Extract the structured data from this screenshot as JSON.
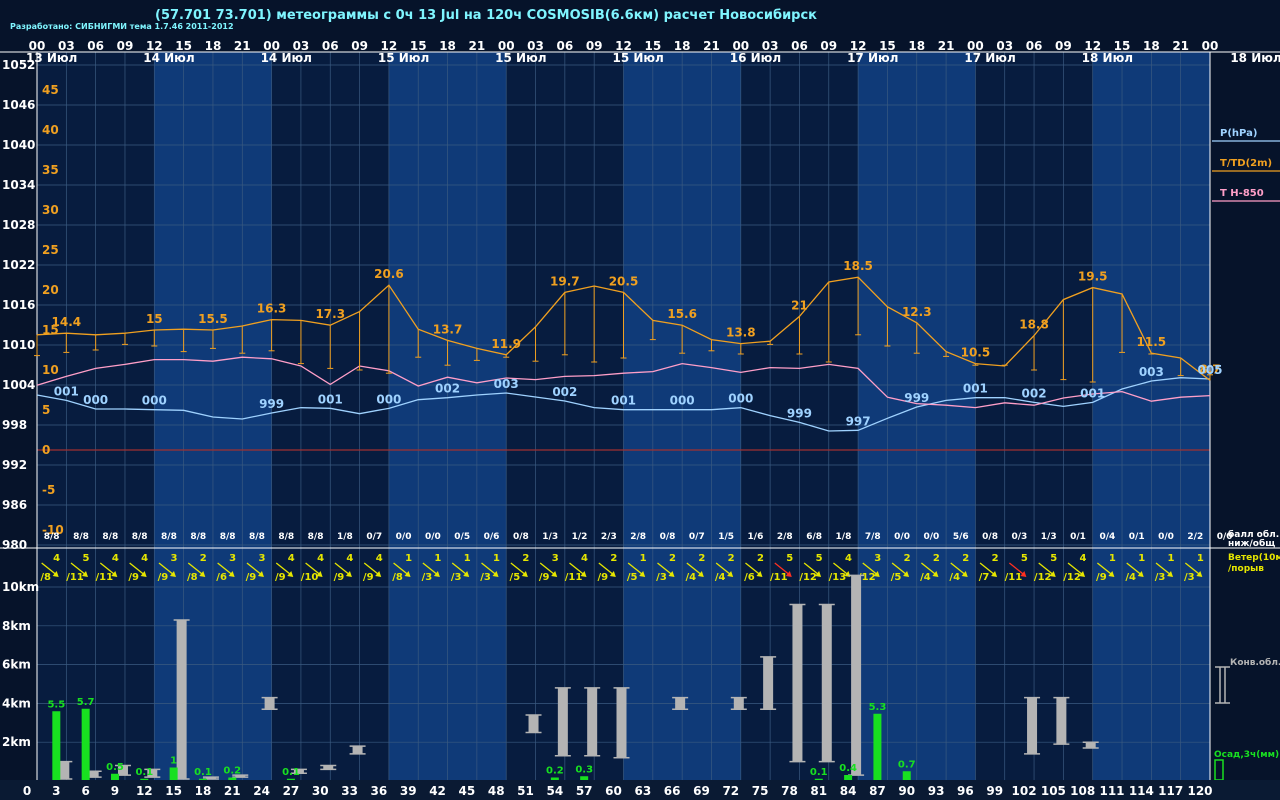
{
  "header": {
    "title": "(57.701 73.701) метеограммы с  0ч 13 Jul на 120ч COSMOSIB(6.6км) расчет Новосибирск",
    "credit": "Разработано: СИБНИГМИ тема 1.7.46 2011-2012"
  },
  "colors": {
    "bg": "#06132a",
    "band_dark": "#071c3f",
    "band_light": "#0f3a78",
    "grid": "#3a5a80",
    "pressure": "#9fd2ff",
    "temp": "#f0a020",
    "t850": "#ff9fc8",
    "rain": "#18e020",
    "cloud": "#b4b4b4",
    "wind": "#e6e600",
    "wind_red": "#ff3020",
    "zero": "#a03030",
    "axis_text": "#ffffff"
  },
  "chart_data": {
    "type": "line",
    "time_labels_top": [
      "00",
      "03",
      "06",
      "09",
      "12",
      "15",
      "18",
      "21",
      "00",
      "03",
      "06",
      "09",
      "12",
      "15",
      "18",
      "21",
      "00",
      "03",
      "06",
      "09",
      "12",
      "15",
      "18",
      "21",
      "00",
      "03",
      "06",
      "09",
      "12",
      "15",
      "18",
      "21",
      "00",
      "03",
      "06",
      "09",
      "12",
      "15",
      "18",
      "21",
      "00"
    ],
    "day_labels": [
      {
        "label": "13 Июл",
        "h": 1.5
      },
      {
        "label": "14 Июл",
        "h": 13.5
      },
      {
        "label": "14 Июл",
        "h": 25.5
      },
      {
        "label": "15 Июл",
        "h": 37.5
      },
      {
        "label": "15 Июл",
        "h": 49.5
      },
      {
        "label": "15 Июл",
        "h": 61.5
      },
      {
        "label": "16 Июл",
        "h": 73.5
      },
      {
        "label": "17 Июл",
        "h": 85.5
      },
      {
        "label": "17 Июл",
        "h": 97.5
      },
      {
        "label": "18 Июл",
        "h": 109.5
      }
    ],
    "right_day_label": "18 Июл",
    "pressure_ticks": [
      "1052",
      "1046",
      "1040",
      "1034",
      "1028",
      "1022",
      "1016",
      "1010",
      "1004",
      "998",
      "992",
      "986",
      "980"
    ],
    "temp_ticks": [
      "45",
      "40",
      "35",
      "30",
      "25",
      "20",
      "15",
      "10",
      "5",
      "0",
      "-5",
      "-10"
    ],
    "legend": [
      "P(hPa)",
      "T/TD(2m)",
      "T H-850"
    ],
    "hours": [
      0,
      3,
      6,
      9,
      12,
      15,
      18,
      21,
      24,
      27,
      30,
      33,
      36,
      39,
      42,
      45,
      48,
      51,
      54,
      57,
      60,
      63,
      66,
      69,
      72,
      75,
      78,
      81,
      84,
      87,
      90,
      93,
      96,
      99,
      102,
      105,
      108,
      111,
      114,
      117,
      120
    ],
    "series": [
      {
        "name": "P(hPa)",
        "values": [
          1002.5,
          1001.7,
          1000.4,
          1000.4,
          1000.3,
          1000.2,
          999.2,
          998.9,
          999.8,
          1000.6,
          1000.5,
          999.7,
          1000.5,
          1001.8,
          1002.1,
          1002.5,
          1002.8,
          1002.2,
          1001.6,
          1000.6,
          1000.3,
          1000.3,
          1000.3,
          1000.3,
          1000.6,
          999.4,
          998.4,
          997.1,
          997.2,
          999.0,
          1000.7,
          1001.7,
          1002.1,
          1002.1,
          1001.4,
          1000.8,
          1001.4,
          1003.4,
          1004.6,
          1005.1,
          1004.9
        ],
        "labels": [
          null,
          "001",
          "000",
          null,
          "000",
          null,
          null,
          null,
          "999",
          null,
          "001",
          null,
          "000",
          null,
          "002",
          null,
          "003",
          null,
          "002",
          null,
          "001",
          null,
          "000",
          null,
          "000",
          null,
          "999",
          null,
          "997",
          null,
          "999",
          null,
          "001",
          null,
          "002",
          null,
          "001",
          null,
          "003",
          null,
          "005"
        ]
      },
      {
        "name": "T/TD(2m)",
        "values": [
          14.4,
          14.6,
          14.4,
          14.6,
          15.0,
          15.1,
          15.0,
          15.5,
          16.3,
          16.2,
          15.6,
          17.3,
          20.6,
          15.1,
          13.7,
          12.7,
          11.9,
          15.4,
          19.7,
          20.5,
          19.7,
          16.2,
          15.6,
          13.8,
          13.3,
          13.6,
          16.7,
          21.0,
          21.6,
          17.9,
          15.9,
          12.3,
          10.8,
          10.5,
          14.3,
          18.8,
          20.3,
          19.5,
          12.1,
          11.5,
          8.7,
          9.0
        ],
        "labels": [
          null,
          "14.4",
          null,
          null,
          "15",
          null,
          "15.5",
          null,
          "16.3",
          null,
          "17.3",
          null,
          "20.6",
          null,
          "13.7",
          null,
          "11.9",
          null,
          "19.7",
          null,
          "20.5",
          null,
          "15.6",
          null,
          "13.8",
          null,
          "21",
          null,
          "18.5",
          null,
          "12.3",
          null,
          "10.5",
          null,
          "18.8",
          null,
          "19.5",
          null,
          "11.5",
          null,
          "8.7"
        ],
        "td": [
          11.8,
          12.2,
          12.5,
          13.2,
          13.0,
          12.3,
          12.7,
          12.1,
          12.4,
          10.8,
          10.2,
          10.0,
          9.6,
          11.6,
          10.6,
          11.2,
          11.6,
          11.1,
          11.9,
          11.0,
          11.5,
          13.8,
          12.1,
          12.4,
          12.0,
          13.2,
          12.0,
          11.0,
          14.4,
          13.0,
          12.1,
          11.7,
          10.6,
          10.6,
          10.0,
          8.8,
          8.5,
          12.2,
          12.0,
          9.3,
          9.4
        ]
      },
      {
        "name": "T H-850",
        "values": [
          8.1,
          9.2,
          10.2,
          10.7,
          11.3,
          11.3,
          11.1,
          11.6,
          11.4,
          10.5,
          8.2,
          10.5,
          9.9,
          8.0,
          9.1,
          8.4,
          9.0,
          8.8,
          9.2,
          9.3,
          9.6,
          9.8,
          10.8,
          10.3,
          9.7,
          10.3,
          10.2,
          10.7,
          10.2,
          6.6,
          5.8,
          5.6,
          5.3,
          5.9,
          5.6,
          6.5,
          7.0,
          7.3,
          6.1,
          6.6,
          6.8
        ]
      }
    ],
    "cloud_cover": [
      "8/8",
      "8/8",
      "8/8",
      "8/8",
      "8/8",
      "8/8",
      "8/8",
      "8/8",
      "8/8",
      "8/8",
      "1/8",
      "0/7",
      "0/0",
      "0/0",
      "0/5",
      "0/6",
      "0/8",
      "1/3",
      "1/2",
      "2/3",
      "2/8",
      "0/8",
      "0/7",
      "1/5",
      "1/6",
      "2/8",
      "6/8",
      "1/8",
      "7/8",
      "0/0",
      "0/0",
      "5/6",
      "0/8",
      "0/3",
      "1/3",
      "0/1",
      "0/4",
      "0/1",
      "0/0",
      "2/2",
      "0/0"
    ],
    "cloud_label": "балл обл. ниж/общ",
    "wind_label": [
      "Ветер(10м)",
      "/порыв"
    ],
    "wind": [
      {
        "speed": "4",
        "gust": "/8"
      },
      {
        "speed": "5",
        "gust": "/11"
      },
      {
        "speed": "4",
        "gust": "/11"
      },
      {
        "speed": "4",
        "gust": "/9"
      },
      {
        "speed": "3",
        "gust": "/9"
      },
      {
        "speed": "2",
        "gust": "/8"
      },
      {
        "speed": "3",
        "gust": "/6"
      },
      {
        "speed": "3",
        "gust": "/9"
      },
      {
        "speed": "4",
        "gust": "/9"
      },
      {
        "speed": "4",
        "gust": "/10"
      },
      {
        "speed": "4",
        "gust": "/9"
      },
      {
        "speed": "4",
        "gust": "/9"
      },
      {
        "speed": "1",
        "gust": "/8"
      },
      {
        "speed": "1",
        "gust": "/3"
      },
      {
        "speed": "1",
        "gust": "/3"
      },
      {
        "speed": "1",
        "gust": "/3"
      },
      {
        "speed": "2",
        "gust": "/5"
      },
      {
        "speed": "3",
        "gust": "/9"
      },
      {
        "speed": "4",
        "gust": "/11"
      },
      {
        "speed": "2",
        "gust": "/9"
      },
      {
        "speed": "1",
        "gust": "/5"
      },
      {
        "speed": "2",
        "gust": "/3"
      },
      {
        "speed": "2",
        "gust": "/4"
      },
      {
        "speed": "2",
        "gust": "/4"
      },
      {
        "speed": "2",
        "gust": "/6"
      },
      {
        "speed": "5",
        "gust": "/11"
      },
      {
        "speed": "5",
        "gust": "/12"
      },
      {
        "speed": "4",
        "gust": "/13"
      },
      {
        "speed": "3",
        "gust": "/12"
      },
      {
        "speed": "2",
        "gust": "/5"
      },
      {
        "speed": "2",
        "gust": "/4"
      },
      {
        "speed": "2",
        "gust": "/4"
      },
      {
        "speed": "2",
        "gust": "/7"
      },
      {
        "speed": "5",
        "gust": "/11"
      },
      {
        "speed": "5",
        "gust": "/12"
      },
      {
        "speed": "4",
        "gust": "/12"
      },
      {
        "speed": "1",
        "gust": "/9"
      },
      {
        "speed": "1",
        "gust": "/4"
      },
      {
        "speed": "1",
        "gust": "/3"
      },
      {
        "speed": "1",
        "gust": "/3"
      }
    ],
    "height_ticks": [
      "10km",
      "8km",
      "6km",
      "4km",
      "2km"
    ],
    "height_ylim": [
      0,
      11
    ],
    "conv_label": "Конв.обл.",
    "precip_label": "Осад,3ч(мм)",
    "precip_hours": [
      3,
      6,
      9,
      12,
      15,
      18,
      21,
      24,
      27,
      30,
      33,
      36,
      39,
      42,
      45,
      48,
      51,
      54,
      57,
      60,
      63,
      66,
      69,
      72,
      75,
      78,
      81,
      84,
      87,
      90,
      93,
      96,
      99,
      102,
      105,
      108,
      111,
      114,
      117,
      120
    ],
    "precip": [
      {
        "h": 3,
        "v": "5.5",
        "val": 5.5
      },
      {
        "h": 6,
        "v": "5.7",
        "val": 5.7
      },
      {
        "h": 9,
        "v": "0.5",
        "val": 0.5
      },
      {
        "h": 12,
        "v": "0.1",
        "val": 0.1
      },
      {
        "h": 15,
        "v": "1",
        "val": 1.0
      },
      {
        "h": 18,
        "v": "0.1",
        "val": 0.1
      },
      {
        "h": 21,
        "v": "0.2",
        "val": 0.2
      },
      {
        "h": 27,
        "v": "0.1",
        "val": 0.1
      },
      {
        "h": 54,
        "v": "0.2",
        "val": 0.2
      },
      {
        "h": 57,
        "v": "0.3",
        "val": 0.3
      },
      {
        "h": 81,
        "v": "0.1",
        "val": 0.1
      },
      {
        "h": 84,
        "v": "0.4",
        "val": 0.4
      },
      {
        "h": 87,
        "v": "5.3",
        "val": 5.3
      },
      {
        "h": 90,
        "v": "0.7",
        "val": 0.7
      }
    ],
    "conv_clouds": [
      {
        "h": 3,
        "bottom": 0.1,
        "top": 1.0
      },
      {
        "h": 6,
        "bottom": 0.2,
        "top": 0.5
      },
      {
        "h": 9,
        "bottom": 0.3,
        "top": 0.8
      },
      {
        "h": 12,
        "bottom": 0.2,
        "top": 0.6
      },
      {
        "h": 15,
        "bottom": 0.1,
        "top": 8.3
      },
      {
        "h": 18,
        "bottom": 0.1,
        "top": 0.2
      },
      {
        "h": 21,
        "bottom": 0.2,
        "top": 0.3
      },
      {
        "h": 24,
        "bottom": 3.7,
        "top": 4.3
      },
      {
        "h": 27,
        "bottom": 0.4,
        "top": 0.6
      },
      {
        "h": 30,
        "bottom": 0.6,
        "top": 0.8
      },
      {
        "h": 33,
        "bottom": 1.4,
        "top": 1.8
      },
      {
        "h": 51,
        "bottom": 2.5,
        "top": 3.4
      },
      {
        "h": 54,
        "bottom": 1.3,
        "top": 4.8
      },
      {
        "h": 57,
        "bottom": 1.3,
        "top": 4.8
      },
      {
        "h": 60,
        "bottom": 1.2,
        "top": 4.8
      },
      {
        "h": 66,
        "bottom": 3.7,
        "top": 4.3
      },
      {
        "h": 72,
        "bottom": 3.7,
        "top": 4.3
      },
      {
        "h": 75,
        "bottom": 3.7,
        "top": 6.4
      },
      {
        "h": 78,
        "bottom": 1.0,
        "top": 9.1
      },
      {
        "h": 81,
        "bottom": 1.0,
        "top": 9.1
      },
      {
        "h": 84,
        "bottom": 0.3,
        "top": 10.6
      },
      {
        "h": 102,
        "bottom": 1.4,
        "top": 4.3
      },
      {
        "h": 105,
        "bottom": 1.9,
        "top": 4.3
      },
      {
        "h": 108,
        "bottom": 1.7,
        "top": 2.0
      }
    ]
  }
}
